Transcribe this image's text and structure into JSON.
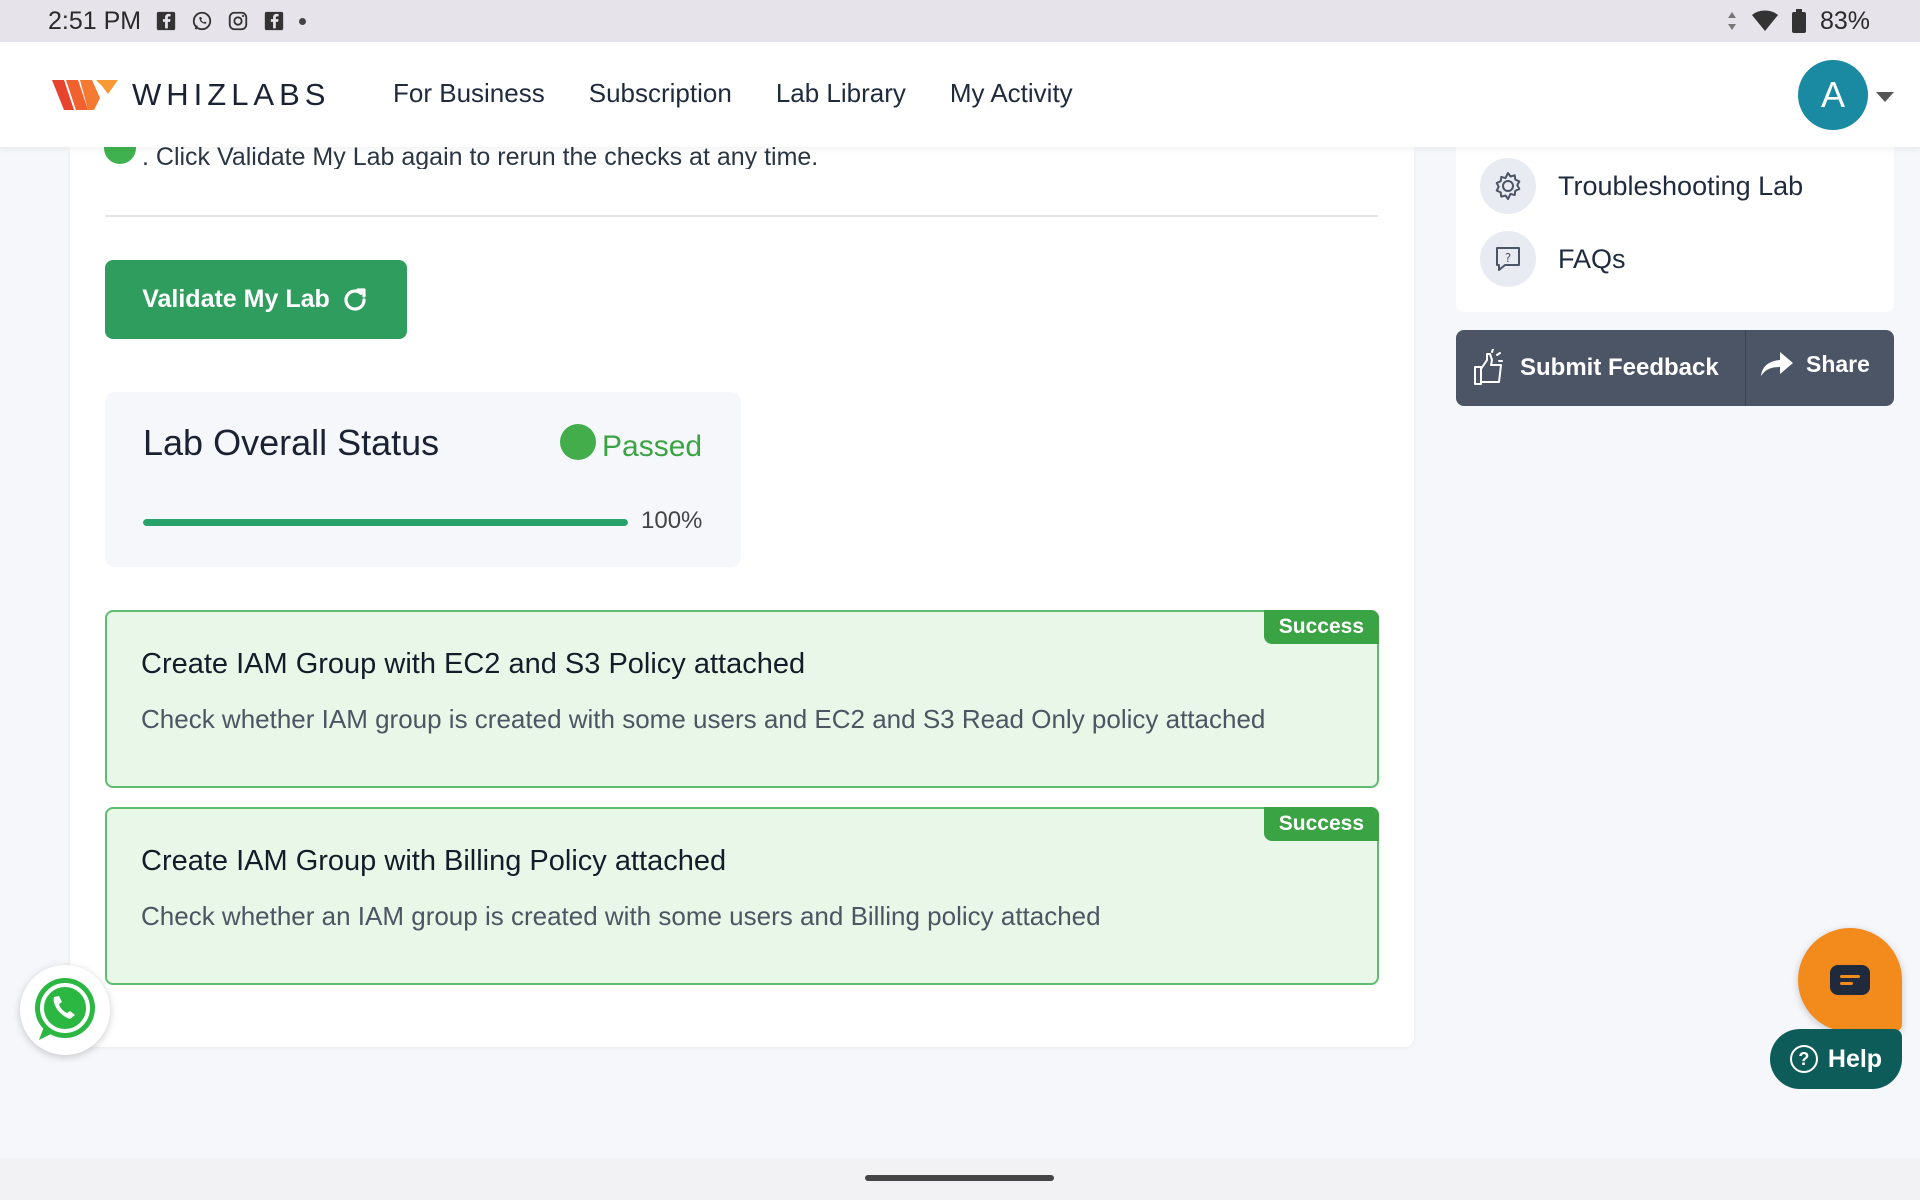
{
  "status_bar": {
    "time": "2:51 PM",
    "battery": "83%",
    "icons": [
      "facebook-icon",
      "whatsapp-icon",
      "instagram-icon",
      "facebook-icon",
      "more-dot-icon",
      "signal-icon",
      "wifi-icon",
      "battery-icon"
    ]
  },
  "header": {
    "brand": "WHIZLABS",
    "nav": [
      "For Business",
      "Subscription",
      "Lab Library",
      "My Activity"
    ],
    "avatar_initial": "A"
  },
  "main": {
    "clipped_text": ". Click Validate My Lab again to rerun the checks at any time.",
    "validate_button": "Validate My Lab",
    "overall": {
      "title": "Lab Overall Status",
      "status": "Passed",
      "progress_label": "100%",
      "progress_value": 1.0
    },
    "checks": [
      {
        "badge": "Success",
        "title": "Create IAM Group with EC2 and S3 Policy attached",
        "description": "Check whether IAM group is created with some users and EC2 and S3 Read Only policy attached"
      },
      {
        "badge": "Success",
        "title": "Create IAM Group with Billing Policy attached",
        "description": "Check whether an IAM group is created with some users and Billing policy attached"
      }
    ]
  },
  "sidebar": {
    "items": [
      {
        "label": "Troubleshooting Lab",
        "icon": "gear-icon"
      },
      {
        "label": "FAQs",
        "icon": "question-chat-icon"
      }
    ],
    "feedback_label": "Submit Feedback",
    "share_label": "Share"
  },
  "floating": {
    "help_label": "Help"
  },
  "colors": {
    "primary_green": "#2e9d5e",
    "success_green": "#3aa343",
    "card_success_bg": "#e8f7e8",
    "avatar": "#1a8aa2",
    "feedback_bar": "#4b5566",
    "chat_orange": "#f28a1c",
    "help_teal": "#0e5c5a"
  }
}
